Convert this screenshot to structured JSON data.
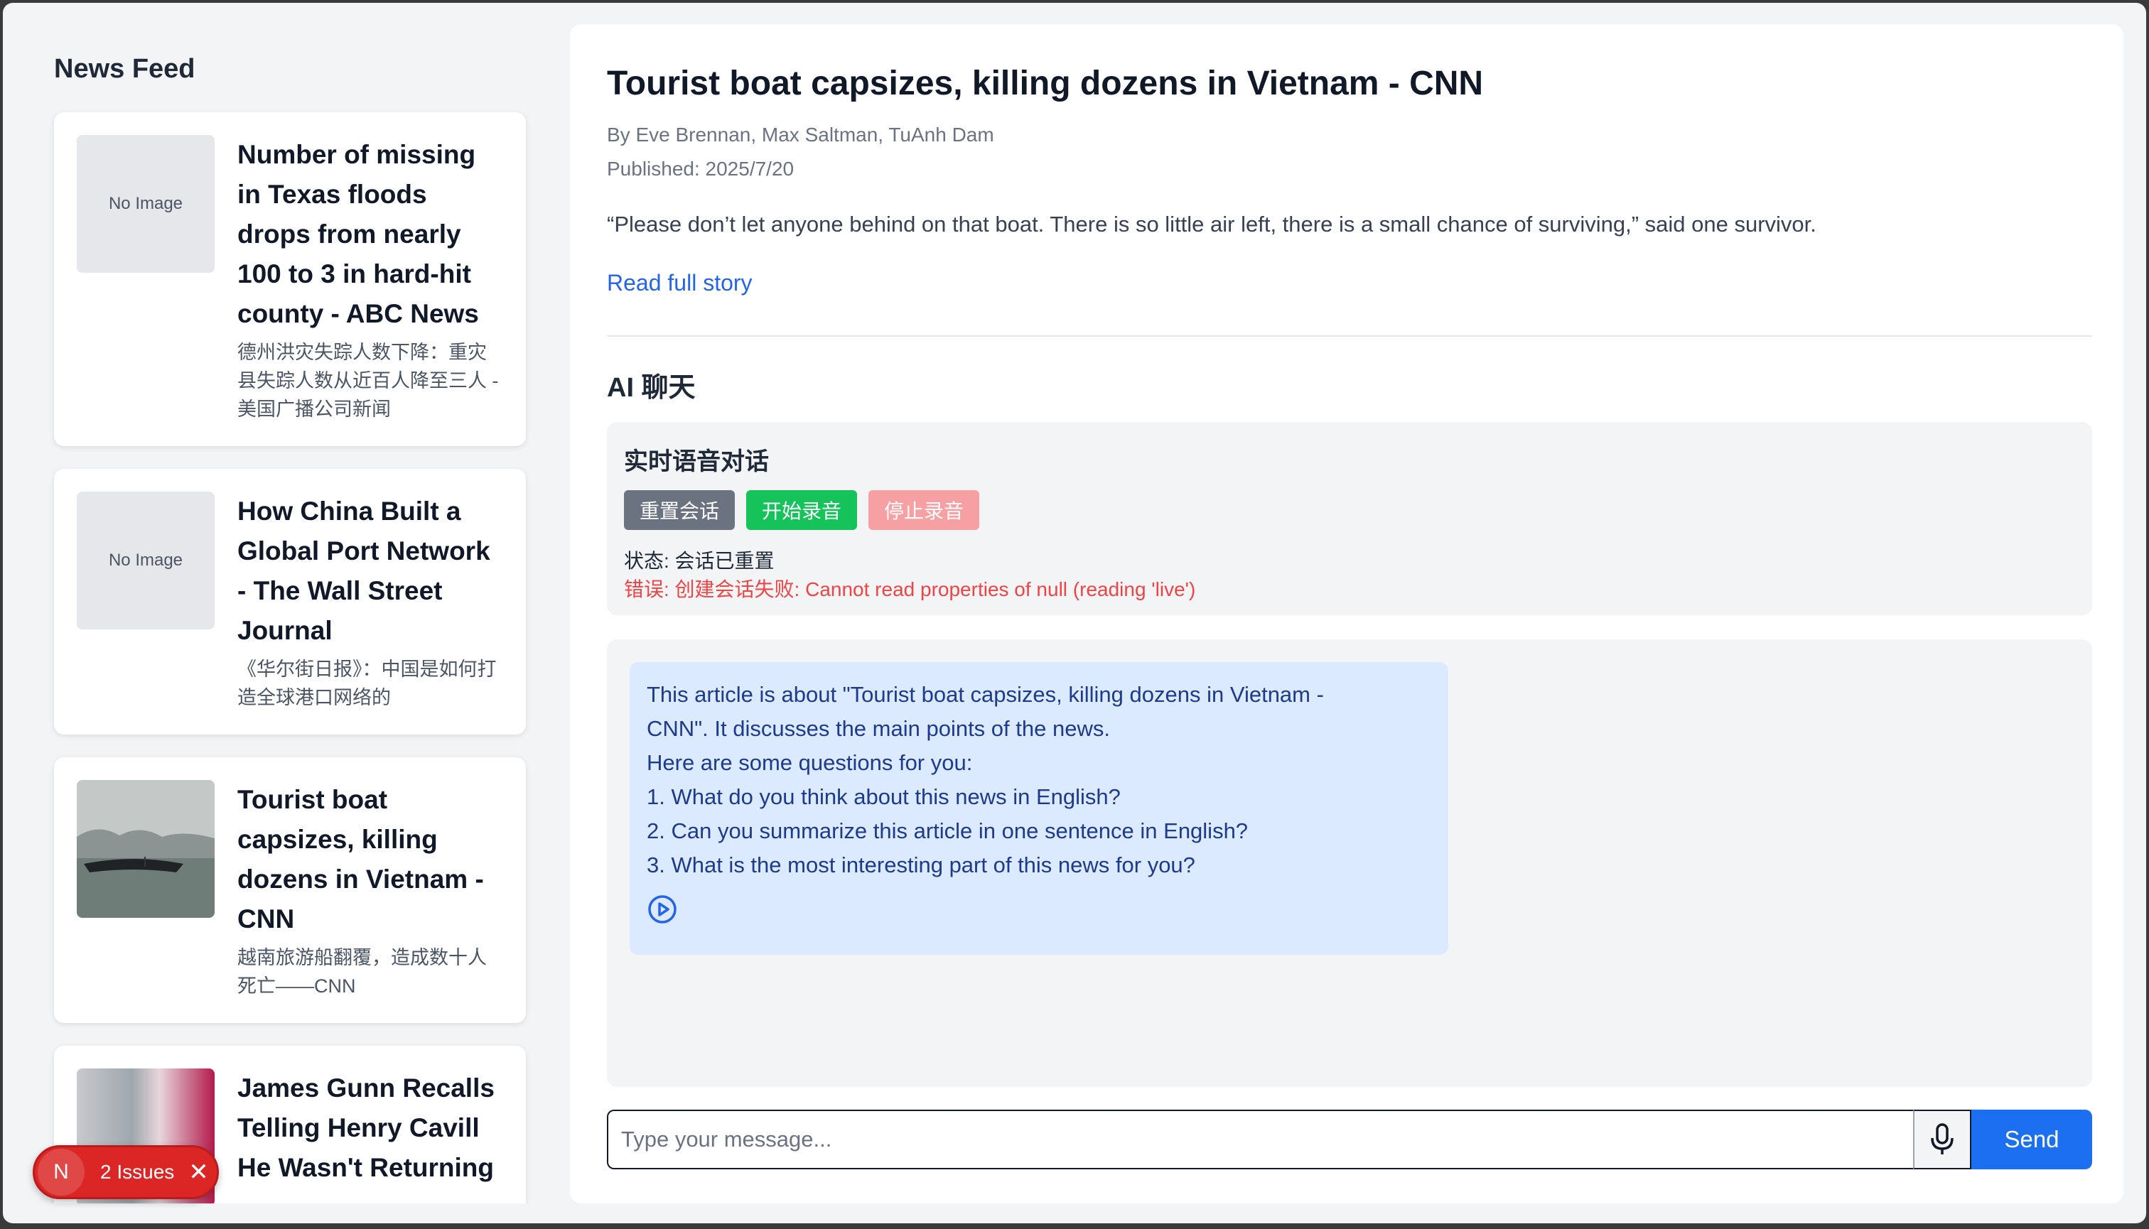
{
  "sidebar": {
    "title": "News Feed",
    "items": [
      {
        "title": "Number of missing in Texas floods drops from nearly 100 to 3 in hard-hit county - ABC News",
        "subtitle": "德州洪灾失踪人数下降：重灾县失踪人数从近百人降至三人 - 美国广播公司新闻",
        "image": "No Image"
      },
      {
        "title": "How China Built a Global Port Network - The Wall Street Journal",
        "subtitle": "《华尔街日报》：中国是如何打造全球港口网络的",
        "image": "No Image"
      },
      {
        "title": "Tourist boat capsizes, killing dozens in Vietnam - CNN",
        "subtitle": "越南旅游船翻覆，造成数十人死亡——CNN",
        "image": ""
      },
      {
        "title": "James Gunn Recalls Telling Henry Cavill He Wasn't Returning",
        "subtitle": "",
        "image": ""
      }
    ]
  },
  "article": {
    "title": "Tourist boat capsizes, killing dozens in Vietnam - CNN",
    "byline": "By Eve Brennan, Max Saltman, TuAnh Dam",
    "published": "Published: 2025/7/20",
    "quote": "“Please don’t let anyone behind on that boat. There is so little air left, there is a small chance of surviving,” said one survivor.",
    "read_more": "Read full story"
  },
  "ai_chat": {
    "title": "AI 聊天",
    "voice": {
      "title": "实时语音对话",
      "reset_label": "重置会话",
      "start_label": "开始录音",
      "stop_label": "停止录音",
      "status": "状态: 会话已重置",
      "error": "错误: 创建会话失败: Cannot read properties of null (reading 'live')"
    },
    "messages": [
      {
        "lines": [
          "This article is about \"Tourist boat capsizes, killing dozens in Vietnam -",
          "CNN\". It discusses the main points of the news.",
          "Here are some questions for you:",
          "1. What do you think about this news in English?",
          "2. Can you summarize this article in one sentence in English?",
          "3. What is the most interesting part of this news for you?"
        ],
        "icon": "play-circle-icon"
      }
    ],
    "input": {
      "placeholder": "Type your message...",
      "value": ""
    },
    "mic_icon": "microphone-icon",
    "send_label": "Send"
  },
  "issues_badge": {
    "initial": "N",
    "label": "2 Issues",
    "close": "✕"
  },
  "colors": {
    "accent": "#1d6ff2",
    "start": "#16c25a",
    "stop": "#f7a0a3",
    "reset": "#6b7280",
    "error": "#ef4444",
    "bubble": "#dbeafe",
    "badge": "#dc2626"
  }
}
